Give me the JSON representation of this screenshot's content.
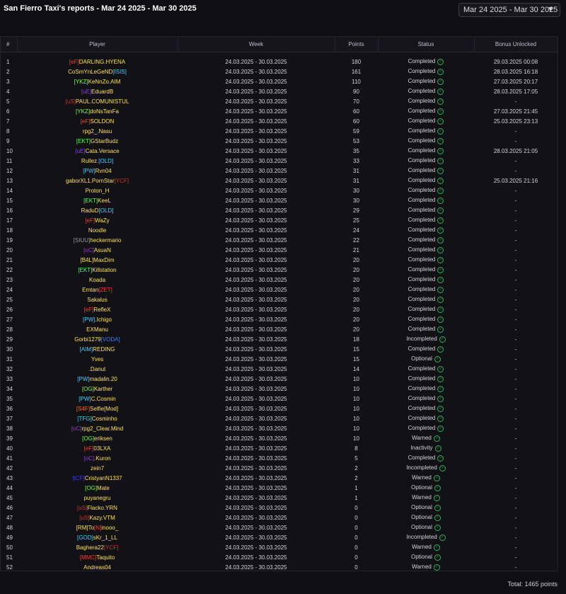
{
  "header": {
    "title": "San Fierro Taxi's reports - Mar 24 2025 - Mar 30 2025",
    "week_selector": "Mar 24 2025 - Mar 30 2025",
    "caret_icon": "chevron-down-icon"
  },
  "columns": [
    "#",
    "Player",
    "Week",
    "Points",
    "Status",
    "Bonus Unlocked"
  ],
  "tag_colors": {
    "eF": "#ff3b30",
    "ISIS": "#3fd0ff",
    "YKZ": "#7cff3a",
    "uE": "#8a3bff",
    "uS": "#c0392b",
    "EKT": "#5dff5d",
    "OLD": "#3fd0ff",
    "PW": "#3fd0ff",
    "YCF": "#c0392b",
    "SIUU": "#9a9aa5",
    "oC": "#9b3bd6",
    "B4L": "#ffe14d",
    "ZET": "#ff3b30",
    "VODA": "#3f7fff",
    "AIM": "#3fd0ff",
    "OG": "#7cff3a",
    "S4F": "#ff6a1a",
    "Mod": "#ffe14d",
    "TFG": "#3fd0ff",
    "RM": "#ffe14d",
    "N": "#ff3b30",
    "GOD": "#3fd0ff",
    "MMC": "#ff3b30",
    "tCF": "#3b3bff",
    "plain": "#ffe14d"
  },
  "rows": [
    {
      "n": "1",
      "player": [
        [
          "[eF]",
          "eF"
        ],
        [
          "DARLING.HYENA",
          "plain"
        ]
      ],
      "week": "24.03.2025 - 30.03.2025",
      "points": "180",
      "status": "Completed",
      "bonus": "29.03.2025 00:08"
    },
    {
      "n": "2",
      "player": [
        [
          "CoSmYnLeGeND",
          "plain"
        ],
        [
          "[ISIS]",
          "ISIS"
        ]
      ],
      "week": "24.03.2025 - 30.03.2025",
      "points": "161",
      "status": "Completed",
      "bonus": "28.03.2025 16:18"
    },
    {
      "n": "3",
      "player": [
        [
          "[YKZ]",
          "YKZ"
        ],
        [
          "KeNnZo.AIM",
          "plain"
        ]
      ],
      "week": "24.03.2025 - 30.03.2025",
      "points": "110",
      "status": "Completed",
      "bonus": "27.03.2025 20:17"
    },
    {
      "n": "4",
      "player": [
        [
          "[uE]",
          "uE"
        ],
        [
          "EduardB",
          "plain"
        ]
      ],
      "week": "24.03.2025 - 30.03.2025",
      "points": "90",
      "status": "Completed",
      "bonus": "28.03.2025 17:05"
    },
    {
      "n": "5",
      "player": [
        [
          "[uS]",
          "uS"
        ],
        [
          "PAUL.COMUNISTUL",
          "plain"
        ]
      ],
      "week": "24.03.2025 - 30.03.2025",
      "points": "70",
      "status": "Completed",
      "bonus": "-"
    },
    {
      "n": "6",
      "player": [
        [
          "[YKZ]",
          "YKZ"
        ],
        [
          "doNsTanFa",
          "plain"
        ]
      ],
      "week": "24.03.2025 - 30.03.2025",
      "points": "60",
      "status": "Completed",
      "bonus": "27.03.2025 21:45"
    },
    {
      "n": "7",
      "player": [
        [
          "[eF]",
          "eF"
        ],
        [
          "SOLDON",
          "plain"
        ]
      ],
      "week": "24.03.2025 - 30.03.2025",
      "points": "60",
      "status": "Completed",
      "bonus": "25.03.2025 23:13"
    },
    {
      "n": "8",
      "player": [
        [
          "rpg2_.Nasu",
          "plain"
        ]
      ],
      "week": "24.03.2025 - 30.03.2025",
      "points": "59",
      "status": "Completed",
      "bonus": "-"
    },
    {
      "n": "9",
      "player": [
        [
          "[EKT]",
          "EKT"
        ],
        [
          "GStarBudz",
          "plain"
        ]
      ],
      "week": "24.03.2025 - 30.03.2025",
      "points": "53",
      "status": "Completed",
      "bonus": "-"
    },
    {
      "n": "10",
      "player": [
        [
          "[uE]",
          "uE"
        ],
        [
          "Cata.Versace",
          "plain"
        ]
      ],
      "week": "24.03.2025 - 30.03.2025",
      "points": "35",
      "status": "Completed",
      "bonus": "28.03.2025 21:05"
    },
    {
      "n": "11",
      "player": [
        [
          "Rullez.",
          "plain"
        ],
        [
          "[OLD]",
          "OLD"
        ]
      ],
      "week": "24.03.2025 - 30.03.2025",
      "points": "33",
      "status": "Completed",
      "bonus": "-"
    },
    {
      "n": "12",
      "player": [
        [
          "[PW]",
          "PW"
        ],
        [
          "Rvn04",
          "plain"
        ]
      ],
      "week": "24.03.2025 - 30.03.2025",
      "points": "31",
      "status": "Completed",
      "bonus": "-"
    },
    {
      "n": "13",
      "player": [
        [
          "gaborXL1.PornStar",
          "plain"
        ],
        [
          "[YCF]",
          "YCF"
        ]
      ],
      "week": "24.03.2025 - 30.03.2025",
      "points": "31",
      "status": "Completed",
      "bonus": "25.03.2025 21:16"
    },
    {
      "n": "14",
      "player": [
        [
          "Proton_H",
          "plain"
        ]
      ],
      "week": "24.03.2025 - 30.03.2025",
      "points": "30",
      "status": "Completed",
      "bonus": "-"
    },
    {
      "n": "15",
      "player": [
        [
          "[EKT]",
          "EKT"
        ],
        [
          "KeeL",
          "plain"
        ]
      ],
      "week": "24.03.2025 - 30.03.2025",
      "points": "30",
      "status": "Completed",
      "bonus": "-"
    },
    {
      "n": "16",
      "player": [
        [
          "RaduD",
          "plain"
        ],
        [
          "[OLD]",
          "OLD"
        ]
      ],
      "week": "24.03.2025 - 30.03.2025",
      "points": "29",
      "status": "Completed",
      "bonus": "-"
    },
    {
      "n": "17",
      "player": [
        [
          "[eF]",
          "eF"
        ],
        [
          "WaZy",
          "plain"
        ]
      ],
      "week": "24.03.2025 - 30.03.2025",
      "points": "25",
      "status": "Completed",
      "bonus": "-"
    },
    {
      "n": "18",
      "player": [
        [
          "Noodle",
          "plain"
        ]
      ],
      "week": "24.03.2025 - 30.03.2025",
      "points": "24",
      "status": "Completed",
      "bonus": "-"
    },
    {
      "n": "19",
      "player": [
        [
          "[SIUU]",
          "SIUU"
        ],
        [
          "heckermario",
          "plain"
        ]
      ],
      "week": "24.03.2025 - 30.03.2025",
      "points": "22",
      "status": "Completed",
      "bonus": "-"
    },
    {
      "n": "20",
      "player": [
        [
          "[oC]",
          "oC"
        ],
        [
          "AsuaN",
          "plain"
        ]
      ],
      "week": "24.03.2025 - 30.03.2025",
      "points": "21",
      "status": "Completed",
      "bonus": "-"
    },
    {
      "n": "21",
      "player": [
        [
          "[B4L]",
          "B4L"
        ],
        [
          "MaxDim",
          "plain"
        ]
      ],
      "week": "24.03.2025 - 30.03.2025",
      "points": "20",
      "status": "Completed",
      "bonus": "-"
    },
    {
      "n": "22",
      "player": [
        [
          "[EKT]",
          "EKT"
        ],
        [
          "Killstation",
          "plain"
        ]
      ],
      "week": "24.03.2025 - 30.03.2025",
      "points": "20",
      "status": "Completed",
      "bonus": "-"
    },
    {
      "n": "23",
      "player": [
        [
          "Koada",
          "plain"
        ]
      ],
      "week": "24.03.2025 - 30.03.2025",
      "points": "20",
      "status": "Completed",
      "bonus": "-"
    },
    {
      "n": "24",
      "player": [
        [
          "Emtan",
          "plain"
        ],
        [
          "[ZET]",
          "ZET"
        ]
      ],
      "week": "24.03.2025 - 30.03.2025",
      "points": "20",
      "status": "Completed",
      "bonus": "-"
    },
    {
      "n": "25",
      "player": [
        [
          "Sakalus",
          "plain"
        ]
      ],
      "week": "24.03.2025 - 30.03.2025",
      "points": "20",
      "status": "Completed",
      "bonus": "-"
    },
    {
      "n": "26",
      "player": [
        [
          "[eF]",
          "eF"
        ],
        [
          "RefleX",
          "plain"
        ]
      ],
      "week": "24.03.2025 - 30.03.2025",
      "points": "20",
      "status": "Completed",
      "bonus": "-"
    },
    {
      "n": "27",
      "player": [
        [
          "[PW]",
          "PW"
        ],
        [
          ".Ichigo",
          "plain"
        ]
      ],
      "week": "24.03.2025 - 30.03.2025",
      "points": "20",
      "status": "Completed",
      "bonus": "-"
    },
    {
      "n": "28",
      "player": [
        [
          "EXManu",
          "plain"
        ]
      ],
      "week": "24.03.2025 - 30.03.2025",
      "points": "20",
      "status": "Completed",
      "bonus": "-"
    },
    {
      "n": "29",
      "player": [
        [
          "Gorbi1279",
          "plain"
        ],
        [
          "[VODA]",
          "VODA"
        ]
      ],
      "week": "24.03.2025 - 30.03.2025",
      "points": "18",
      "status": "Incompleted",
      "bonus": "-"
    },
    {
      "n": "30",
      "player": [
        [
          "[AIM]",
          "AIM"
        ],
        [
          "REDING",
          "plain"
        ]
      ],
      "week": "24.03.2025 - 30.03.2025",
      "points": "15",
      "status": "Completed",
      "bonus": "-"
    },
    {
      "n": "31",
      "player": [
        [
          "Yves",
          "plain"
        ]
      ],
      "week": "24.03.2025 - 30.03.2025",
      "points": "15",
      "status": "Optional",
      "bonus": "-"
    },
    {
      "n": "32",
      "player": [
        [
          ".Danut",
          "plain"
        ]
      ],
      "week": "24.03.2025 - 30.03.2025",
      "points": "14",
      "status": "Completed",
      "bonus": "-"
    },
    {
      "n": "33",
      "player": [
        [
          "[PW]",
          "PW"
        ],
        [
          "madalin.20",
          "plain"
        ]
      ],
      "week": "24.03.2025 - 30.03.2025",
      "points": "10",
      "status": "Completed",
      "bonus": "-"
    },
    {
      "n": "34",
      "player": [
        [
          "[OG]",
          "OG"
        ],
        [
          "Karther",
          "plain"
        ]
      ],
      "week": "24.03.2025 - 30.03.2025",
      "points": "10",
      "status": "Completed",
      "bonus": "-"
    },
    {
      "n": "35",
      "player": [
        [
          "[PW]",
          "PW"
        ],
        [
          "C.Cosmin",
          "plain"
        ]
      ],
      "week": "24.03.2025 - 30.03.2025",
      "points": "10",
      "status": "Completed",
      "bonus": "-"
    },
    {
      "n": "36",
      "player": [
        [
          "[S4F]",
          "S4F"
        ],
        [
          "Selfie",
          "plain"
        ],
        [
          "[Mod]",
          "Mod"
        ]
      ],
      "week": "24.03.2025 - 30.03.2025",
      "points": "10",
      "status": "Completed",
      "bonus": "-"
    },
    {
      "n": "37",
      "player": [
        [
          "[TFG]",
          "TFG"
        ],
        [
          "Cosminho",
          "plain"
        ]
      ],
      "week": "24.03.2025 - 30.03.2025",
      "points": "10",
      "status": "Completed",
      "bonus": "-"
    },
    {
      "n": "38",
      "player": [
        [
          "[oC]",
          "oC"
        ],
        [
          "rpg2_Clear.Mind",
          "plain"
        ]
      ],
      "week": "24.03.2025 - 30.03.2025",
      "points": "10",
      "status": "Completed",
      "bonus": "-"
    },
    {
      "n": "39",
      "player": [
        [
          "[OG]",
          "OG"
        ],
        [
          "eriksen",
          "plain"
        ]
      ],
      "week": "24.03.2025 - 30.03.2025",
      "points": "10",
      "status": "Warned",
      "bonus": "-"
    },
    {
      "n": "40",
      "player": [
        [
          "[eF]",
          "eF"
        ],
        [
          "03LXA",
          "plain"
        ]
      ],
      "week": "24.03.2025 - 30.03.2025",
      "points": "8",
      "status": "Inactivity",
      "bonus": "-"
    },
    {
      "n": "41",
      "player": [
        [
          "[oC]",
          "oC"
        ],
        [
          ".Kuron",
          "plain"
        ]
      ],
      "week": "24.03.2025 - 30.03.2025",
      "points": "5",
      "status": "Completed",
      "bonus": "-"
    },
    {
      "n": "42",
      "player": [
        [
          "zein7",
          "plain"
        ]
      ],
      "week": "24.03.2025 - 30.03.2025",
      "points": "2",
      "status": "Incompleted",
      "bonus": "-"
    },
    {
      "n": "43",
      "player": [
        [
          "[tCF]",
          "tCF"
        ],
        [
          "CristyanN1337",
          "plain"
        ]
      ],
      "week": "24.03.2025 - 30.03.2025",
      "points": "2",
      "status": "Warned",
      "bonus": "-"
    },
    {
      "n": "44",
      "player": [
        [
          "[OG]",
          "OG"
        ],
        [
          "Mate",
          "plain"
        ]
      ],
      "week": "24.03.2025 - 30.03.2025",
      "points": "1",
      "status": "Optional",
      "bonus": "-"
    },
    {
      "n": "45",
      "player": [
        [
          "puyanegru",
          "plain"
        ]
      ],
      "week": "24.03.2025 - 30.03.2025",
      "points": "1",
      "status": "Warned",
      "bonus": "-"
    },
    {
      "n": "46",
      "player": [
        [
          "[uS]",
          "uS"
        ],
        [
          "Flacko.YRN",
          "plain"
        ]
      ],
      "week": "24.03.2025 - 30.03.2025",
      "points": "0",
      "status": "Optional",
      "bonus": "-"
    },
    {
      "n": "47",
      "player": [
        [
          "[uS]",
          "uS"
        ],
        [
          "Kazy.VTM",
          "plain"
        ]
      ],
      "week": "24.03.2025 - 30.03.2025",
      "points": "0",
      "status": "Optional",
      "bonus": "-"
    },
    {
      "n": "48",
      "player": [
        [
          "[RM]",
          "RM"
        ],
        [
          "To",
          "plain"
        ],
        [
          "[N]",
          "N"
        ],
        [
          "inooo_",
          "plain"
        ]
      ],
      "week": "24.03.2025 - 30.03.2025",
      "points": "0",
      "status": "Optional",
      "bonus": "-"
    },
    {
      "n": "49",
      "player": [
        [
          "[GOD]",
          "GOD"
        ],
        [
          "sKr_1_LL",
          "plain"
        ]
      ],
      "week": "24.03.2025 - 30.03.2025",
      "points": "0",
      "status": "Incompleted",
      "bonus": "-"
    },
    {
      "n": "50",
      "player": [
        [
          "Baghera22",
          "plain"
        ],
        [
          "[YCF]",
          "YCF"
        ]
      ],
      "week": "24.03.2025 - 30.03.2025",
      "points": "0",
      "status": "Warned",
      "bonus": "-"
    },
    {
      "n": "51",
      "player": [
        [
          "[MMC]",
          "MMC"
        ],
        [
          "Taquito",
          "plain"
        ]
      ],
      "week": "24.03.2025 - 30.03.2025",
      "points": "0",
      "status": "Optional",
      "bonus": "-"
    },
    {
      "n": "52",
      "player": [
        [
          "Andreas04",
          "plain"
        ]
      ],
      "week": "24.03.2025 - 30.03.2025",
      "points": "0",
      "status": "Warned",
      "bonus": "-"
    }
  ],
  "status_icon": "check-circle-icon",
  "footer": {
    "total": "Total: 1465 points"
  }
}
